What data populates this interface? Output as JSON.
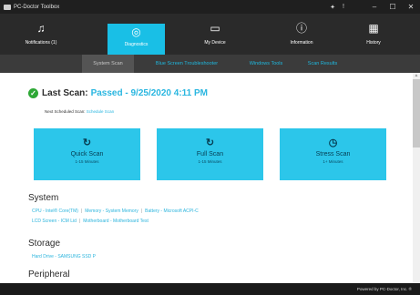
{
  "titlebar": {
    "app_title": "PC-Doctor Toolbox",
    "icons": [
      "pin-icon",
      "info-icon"
    ],
    "icon_glyphs": [
      "✦",
      "!"
    ],
    "window_controls": [
      "–",
      "☐",
      "✕"
    ]
  },
  "nav": {
    "items": [
      {
        "label": "Notifications (1)",
        "icon": "bell-icon",
        "glyph": "♫"
      },
      {
        "label": "Diagnostics",
        "icon": "diagnostics-icon",
        "glyph": "◎"
      },
      {
        "label": "My Device",
        "icon": "monitor-icon",
        "glyph": "▭"
      },
      {
        "label": "Information",
        "icon": "info-circle-icon",
        "glyph": "ⓘ"
      },
      {
        "label": "History",
        "icon": "calendar-icon",
        "glyph": "▦"
      }
    ],
    "active": "Diagnostics"
  },
  "subnav": {
    "tabs": [
      "System Scan",
      "Blue Screen Troubleshooter",
      "Windows Tools",
      "Scan Results"
    ],
    "active": "System Scan"
  },
  "last_scan": {
    "label": "Last Scan:",
    "value": "Passed - 9/25/2020 4:11 PM"
  },
  "next_scan": {
    "label": "Next Scheduled Scan:",
    "link": "Schedule Scan"
  },
  "scans": [
    {
      "name": "Quick Scan",
      "duration": "1-15 Minutes",
      "icon": "refresh-icon",
      "glyph": "↻"
    },
    {
      "name": "Full Scan",
      "duration": "1-15 Minutes",
      "icon": "refresh-icon",
      "glyph": "↻"
    },
    {
      "name": "Stress Scan",
      "duration": "1+ Minutes",
      "icon": "timer-icon",
      "glyph": "◷"
    }
  ],
  "system": {
    "title": "System",
    "line1": [
      "CPU - Intel® Core(TM)",
      "Memory - System Memory",
      "Battery - Microsoft ACPI-C"
    ],
    "line2": [
      "LCD Screen - ICM Lid",
      "Motherboard - Motherboard Test"
    ]
  },
  "storage": {
    "title": "Storage",
    "line1": [
      "Hard Drive - SAMSUNG SSD P"
    ]
  },
  "peripheral": {
    "title": "Peripheral"
  },
  "footer": {
    "text": "Powered by PC-Doctor, Inc. ®"
  },
  "colors": {
    "accent": "#19bfe6",
    "card": "#2cc6ea",
    "passed_green": "#2ea836",
    "link_blue": "#29b6e0",
    "nav_dark": "#2a2a2a"
  }
}
